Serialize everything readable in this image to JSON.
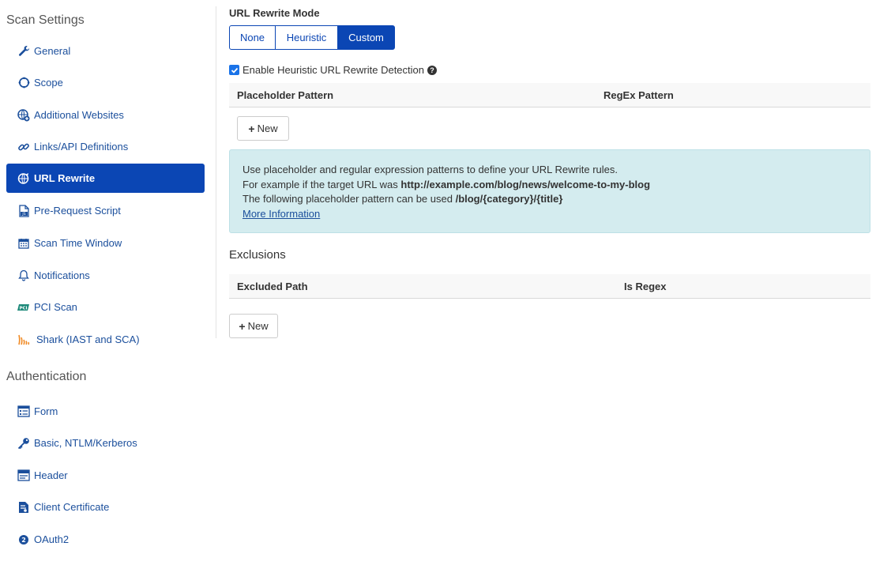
{
  "sidebar": {
    "scan_settings_title": "Scan Settings",
    "scan_items": [
      {
        "label": "General",
        "icon": "wrench-icon"
      },
      {
        "label": "Scope",
        "icon": "circle-scope-icon"
      },
      {
        "label": "Additional Websites",
        "icon": "globe-plus-icon"
      },
      {
        "label": "Links/API Definitions",
        "icon": "chain-link-icon"
      },
      {
        "label": "URL Rewrite",
        "icon": "globe-rewrite-icon",
        "active": true
      },
      {
        "label": "Pre-Request Script",
        "icon": "script-file-icon"
      },
      {
        "label": "Scan Time Window",
        "icon": "calendar-icon"
      },
      {
        "label": "Notifications",
        "icon": "bell-icon"
      },
      {
        "label": "PCI Scan",
        "icon": "pci-badge-icon"
      },
      {
        "label": "Shark (IAST and SCA)",
        "icon": "shark-signal-icon"
      }
    ],
    "authentication_title": "Authentication",
    "auth_items": [
      {
        "label": "Form",
        "icon": "form-icon"
      },
      {
        "label": "Basic, NTLM/Kerberos",
        "icon": "key-icon"
      },
      {
        "label": "Header",
        "icon": "header-window-icon"
      },
      {
        "label": "Client Certificate",
        "icon": "certificate-icon"
      },
      {
        "label": "OAuth2",
        "icon": "oauth2-icon"
      }
    ]
  },
  "main": {
    "mode_label": "URL Rewrite Mode",
    "modes": [
      {
        "label": "None",
        "active": false
      },
      {
        "label": "Heuristic",
        "active": false
      },
      {
        "label": "Custom",
        "active": true
      }
    ],
    "heuristic_checkbox_label": "Enable Heuristic URL Rewrite Detection",
    "heuristic_checked": true,
    "patterns_table": {
      "col_placeholder": "Placeholder Pattern",
      "col_regex": "RegEx Pattern",
      "new_label": "New"
    },
    "info": {
      "line1": "Use placeholder and regular expression patterns to define your URL Rewrite rules.",
      "line2_prefix": "For example if the target URL was ",
      "line2_url": "http://example.com/blog/news/welcome-to-my-blog",
      "line3_prefix": "The following placeholder pattern can be used ",
      "line3_pattern": "/blog/{category}/{title}",
      "more_link": "More Information"
    },
    "exclusions_title": "Exclusions",
    "exclusions_table": {
      "col_path": "Excluded Path",
      "col_regex": "Is Regex",
      "new_label": "New"
    }
  },
  "colors": {
    "accent": "#0b46b4",
    "link": "#1b4f9c",
    "info_bg": "#d4ecef"
  }
}
